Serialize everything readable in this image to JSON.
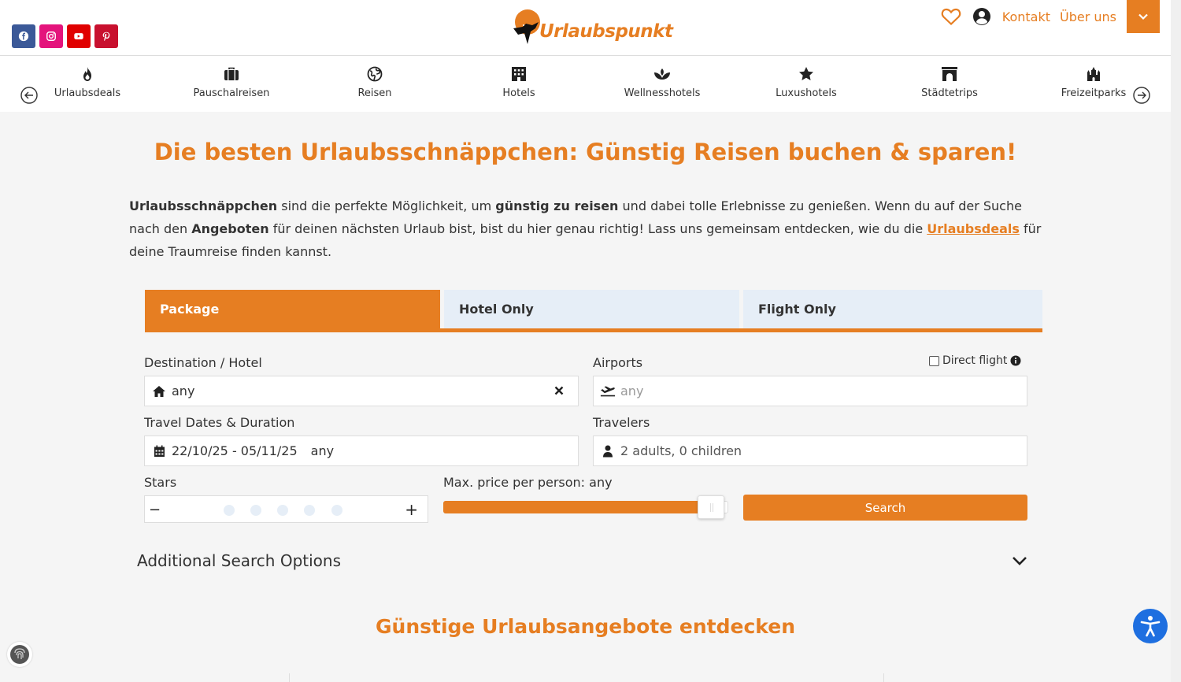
{
  "header": {
    "logo_text": "Urlaubspunkt",
    "links": [
      "Kontakt",
      "Über uns"
    ],
    "socials": [
      {
        "name": "facebook",
        "color": "#3b5998"
      },
      {
        "name": "instagram",
        "color": "#e4147c"
      },
      {
        "name": "youtube",
        "color": "#e00000"
      },
      {
        "name": "pinterest",
        "color": "#c8102e"
      }
    ],
    "accent": "#e67e22"
  },
  "categories": [
    {
      "label": "Urlaubsdeals",
      "icon": "fire-icon"
    },
    {
      "label": "Pauschalreisen",
      "icon": "suitcase-icon"
    },
    {
      "label": "Reisen",
      "icon": "globe-icon"
    },
    {
      "label": "Hotels",
      "icon": "hotel-icon"
    },
    {
      "label": "Wellnesshotels",
      "icon": "spa-icon"
    },
    {
      "label": "Luxushotels",
      "icon": "star-icon"
    },
    {
      "label": "Städtetrips",
      "icon": "archway-icon"
    },
    {
      "label": "Freizeitparks",
      "icon": "castle-icon"
    }
  ],
  "main": {
    "title": "Die besten Urlaubsschnäppchen: Günstig Reisen buchen & sparen!",
    "intro": {
      "b1": "Urlaubsschnäppchen",
      "t1": " sind die perfekte Möglichkeit, um ",
      "b2": "günstig zu reisen",
      "t2": " und dabei tolle Erlebnisse zu genießen. Wenn du auf der Suche nach den ",
      "b3": "Angeboten",
      "t3": " für deinen nächsten Urlaub bist, bist du hier genau richtig! Lass uns gemeinsam entdecken, wie du die ",
      "link": "Urlaubsdeals",
      "t4": " für deine Traumreise finden kannst."
    },
    "section_title": "Günstige Urlaubsangebote entdecken"
  },
  "search": {
    "tabs": [
      "Package",
      "Hotel Only",
      "Flight Only"
    ],
    "destination_label": "Destination / Hotel",
    "destination_value": "any",
    "airports_label": "Airports",
    "airports_placeholder": "any",
    "direct_flight_label": "Direct flight",
    "dates_label": "Travel Dates & Duration",
    "dates_value": "22/10/25 - 05/11/25",
    "duration_value": "any",
    "travelers_label": "Travelers",
    "travelers_value": "2 adults, 0 children",
    "stars_label": "Stars",
    "stars_selected": 0,
    "stars_max": 5,
    "price_label": "Max. price per person: any",
    "price_fraction": 0.91,
    "search_button": "Search",
    "additional_options": "Additional Search Options"
  }
}
